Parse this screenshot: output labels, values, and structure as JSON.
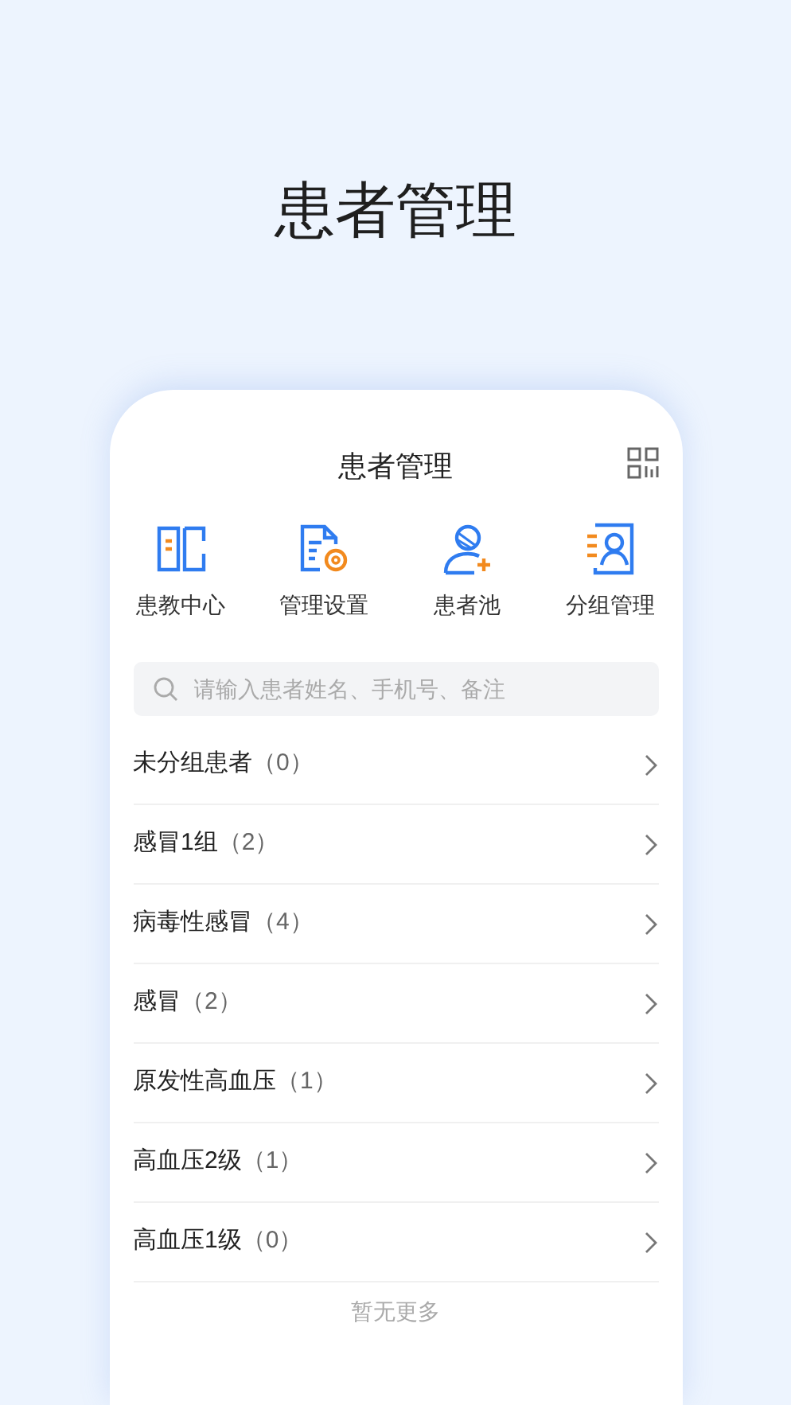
{
  "headline": "患者管理",
  "screen": {
    "title": "患者管理",
    "shortcuts": [
      {
        "kind": "book",
        "label": "患教中心"
      },
      {
        "kind": "doc-gear",
        "label": "管理设置"
      },
      {
        "kind": "user-add",
        "label": "患者池"
      },
      {
        "kind": "contact",
        "label": "分组管理"
      }
    ],
    "search": {
      "placeholder": "请输入患者姓名、手机号、备注"
    },
    "groups": [
      {
        "name": "未分组患者",
        "count": "（0）"
      },
      {
        "name": "感冒1组",
        "count": "（2）"
      },
      {
        "name": "病毒性感冒",
        "count": "（4）"
      },
      {
        "name": "感冒",
        "count": "（2）"
      },
      {
        "name": "原发性高血压",
        "count": "（1）"
      },
      {
        "name": "高血压2级",
        "count": "（1）"
      },
      {
        "name": "高血压1级",
        "count": "（0）"
      }
    ],
    "footer": "暂无更多"
  }
}
